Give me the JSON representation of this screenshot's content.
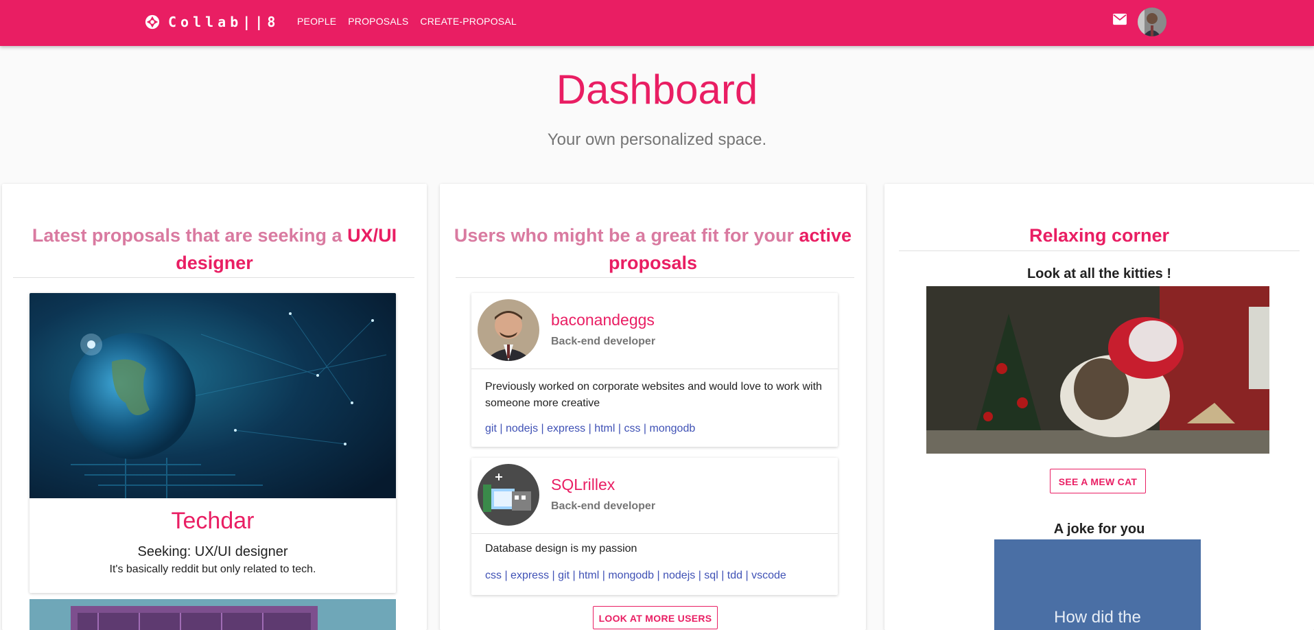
{
  "nav": {
    "brand": "Collab||8",
    "links": [
      "PEOPLE",
      "PROPOSALS",
      "CREATE-PROPOSAL"
    ]
  },
  "header": {
    "title": "Dashboard",
    "subtitle": "Your own personalized space."
  },
  "col1": {
    "title_part1": "Latest proposals that are seeking a ",
    "title_part2": "UX/UI",
    "title_line2": "designer",
    "proposal": {
      "name": "Techdar",
      "seeking": "Seeking: UX/UI designer",
      "description": "It's basically reddit but only related to tech."
    }
  },
  "col2": {
    "title_part1": "Users who might be a great fit for your ",
    "title_part2": "active",
    "title_line2": "proposals",
    "users": [
      {
        "name": "baconandeggs",
        "role": "Back-end developer",
        "bio": "Previously worked on corporate websites and would love to work with someone more creative",
        "tags": "git | nodejs | express | html | css | mongodb"
      },
      {
        "name": "SQLrillex",
        "role": "Back-end developer",
        "bio": "Database design is my passion",
        "tags": "css | express | git | html | mongodb | nodejs | sql | tdd | vscode"
      }
    ],
    "more_button": "LOOK AT MORE USERS"
  },
  "col3": {
    "title": "Relaxing corner",
    "kitties_title": "Look at all the kitties !",
    "mew_button": "SEE A MEW CAT",
    "joke_title": "A joke for you",
    "joke_text": "How did the"
  },
  "colors": {
    "primary": "#e91e63",
    "tag_link": "#3f51b5"
  }
}
